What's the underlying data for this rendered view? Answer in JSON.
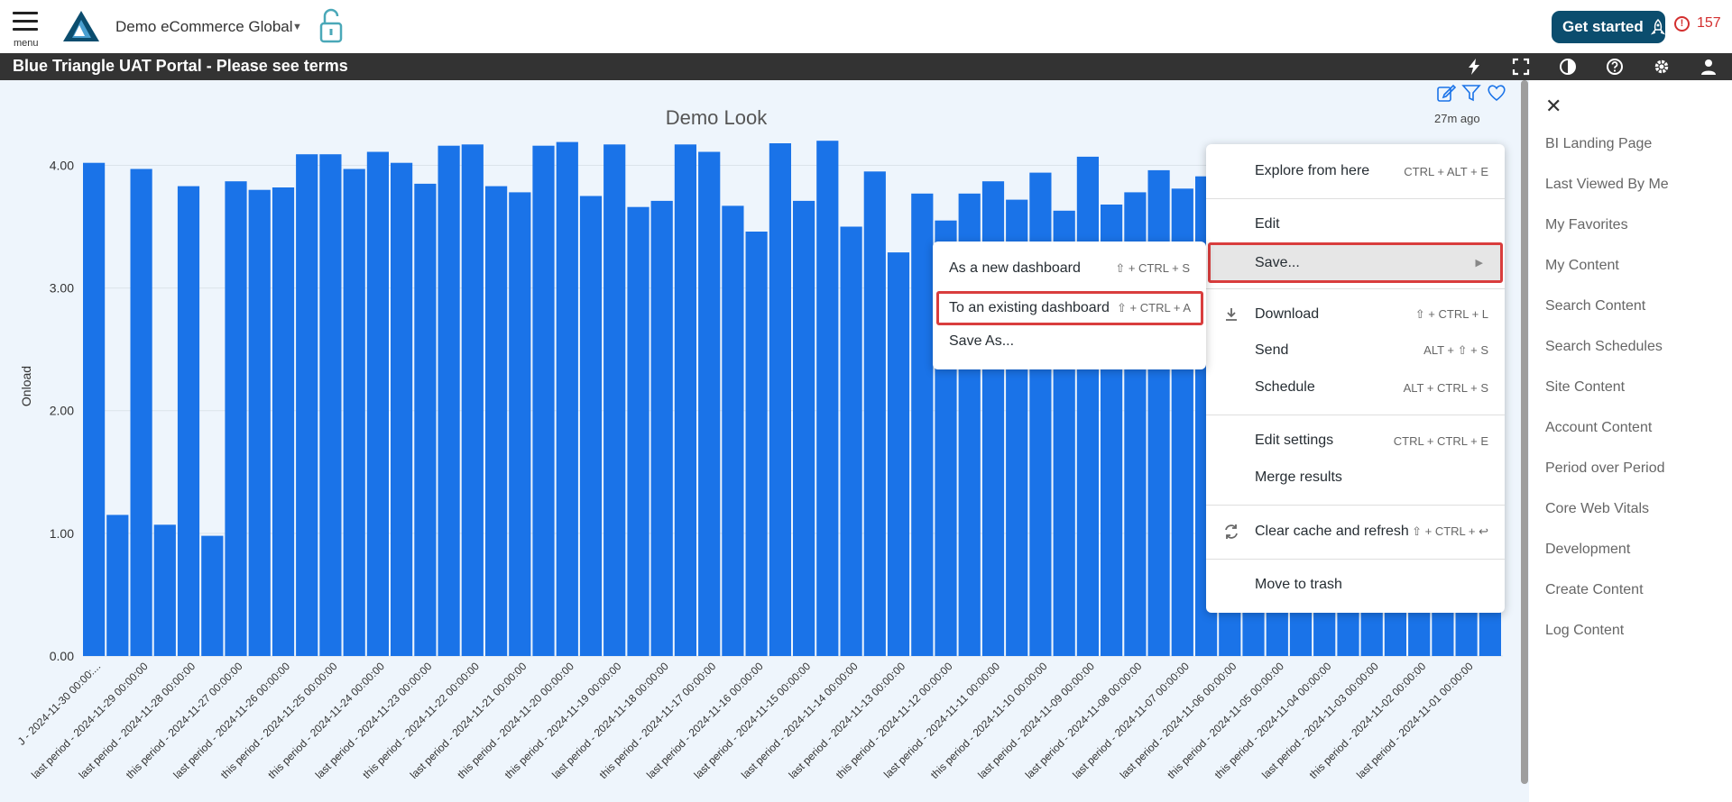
{
  "header": {
    "menu_label": "menu",
    "tenant": "Demo eCommerce Global",
    "get_started": "Get started",
    "alert_count": "157"
  },
  "band": {
    "title": "Blue Triangle UAT Portal - Please see terms",
    "icons": [
      "lightning-icon",
      "fullscreen-icon",
      "contrast-icon",
      "help-icon",
      "settings-icon",
      "user-icon"
    ]
  },
  "tile": {
    "updated": "27m ago"
  },
  "right_panel": {
    "items": [
      "BI Landing Page",
      "Last Viewed By Me",
      "My Favorites",
      "My Content",
      "Search Content",
      "Search Schedules",
      "Site Content",
      "Account Content",
      "Period over Period",
      "Core Web Vitals",
      "Development",
      "Create Content",
      "Log Content"
    ]
  },
  "context_menu": {
    "items": [
      {
        "label": "Explore from here",
        "shortcut": "CTRL + ALT + E"
      },
      {
        "label": "Edit",
        "shortcut": ""
      },
      {
        "label": "Save...",
        "shortcut": ""
      },
      {
        "label": "Download",
        "shortcut": "⇧ + CTRL + L"
      },
      {
        "label": "Send",
        "shortcut": "ALT + ⇧ + S"
      },
      {
        "label": "Schedule",
        "shortcut": "ALT + CTRL + S"
      },
      {
        "label": "Edit settings",
        "shortcut": "CTRL + CTRL + E"
      },
      {
        "label": "Merge results",
        "shortcut": ""
      },
      {
        "label": "Clear cache and refresh",
        "shortcut": "⇧ + CTRL + ↩"
      },
      {
        "label": "Move to trash",
        "shortcut": ""
      }
    ]
  },
  "save_submenu": {
    "items": [
      {
        "label": "As a new dashboard",
        "shortcut": "⇧ + CTRL + S"
      },
      {
        "label": "To an existing dashboard",
        "shortcut": "⇧ + CTRL + A"
      },
      {
        "label": "Save As...",
        "shortcut": ""
      }
    ]
  },
  "colors": {
    "bar": "#1a73e8",
    "highlight": "#d93d3d",
    "band": "#333333",
    "get_started_bg": "#0b4d6e"
  },
  "chart_data": {
    "type": "bar",
    "title": "Demo Look",
    "ylabel": "Onload",
    "xlabel": "",
    "ylim": [
      0,
      4.4
    ],
    "yticks": [
      "0.00",
      "1.00",
      "2.00",
      "3.00",
      "4.00"
    ],
    "grid": true,
    "categories": [
      "this period - 2024-11-30 00:00:...",
      "last period - 2024-11-30 00:00:00",
      "this period - 2024-11-29 00:00:00",
      "last period - 2024-11-29 00:00:00",
      "this period - 2024-11-28 00:00:00",
      "last period - 2024-11-28 00:00:00",
      "this period - 2024-11-27 00:00:00",
      "last period - 2024-11-27 00:00:00",
      "this period - 2024-11-26 00:00:00",
      "last period - 2024-11-26 00:00:00",
      "this period - 2024-11-25 00:00:00",
      "last period - 2024-11-25 00:00:00",
      "this period - 2024-11-24 00:00:00",
      "last period - 2024-11-24 00:00:00",
      "this period - 2024-11-23 00:00:00",
      "last period - 2024-11-23 00:00:00",
      "this period - 2024-11-22 00:00:00",
      "last period - 2024-11-22 00:00:00",
      "this period - 2024-11-21 00:00:00",
      "last period - 2024-11-21 00:00:00",
      "this period - 2024-11-20 00:00:00",
      "last period - 2024-11-20 00:00:00",
      "this period - 2024-11-19 00:00:00",
      "last period - 2024-11-19 00:00:00",
      "this period - 2024-11-18 00:00:00",
      "last period - 2024-11-18 00:00:00",
      "this period - 2024-11-17 00:00:00",
      "last period - 2024-11-17 00:00:00",
      "this period - 2024-11-16 00:00:00",
      "last period - 2024-11-16 00:00:00",
      "this period - 2024-11-15 00:00:00",
      "last period - 2024-11-15 00:00:00",
      "this period - 2024-11-14 00:00:00",
      "last period - 2024-11-14 00:00:00",
      "this period - 2024-11-13 00:00:00",
      "last period - 2024-11-13 00:00:00",
      "this period - 2024-11-12 00:00:00",
      "last period - 2024-11-12 00:00:00",
      "this period - 2024-11-11 00:00:00",
      "last period - 2024-11-11 00:00:00",
      "this period - 2024-11-10 00:00:00",
      "last period - 2024-11-10 00:00:00",
      "this period - 2024-11-09 00:00:00",
      "last period - 2024-11-09 00:00:00",
      "this period - 2024-11-08 00:00:00",
      "last period - 2024-11-08 00:00:00",
      "this period - 2024-11-07 00:00:00",
      "last period - 2024-11-07 00:00:00",
      "this period - 2024-11-06 00:00:00",
      "last period - 2024-11-06 00:00:00",
      "this period - 2024-11-05 00:00:00",
      "last period - 2024-11-05 00:00:00",
      "this period - 2024-11-04 00:00:00",
      "last period - 2024-11-04 00:00:00",
      "this period - 2024-11-03 00:00:00",
      "last period - 2024-11-03 00:00:00",
      "this period - 2024-11-02 00:00:00",
      "last period - 2024-11-02 00:00:00",
      "this period - 2024-11-01 00:00:00",
      "last period - 2024-11-01 00:00:00"
    ],
    "values": [
      4.02,
      1.15,
      3.97,
      1.07,
      3.83,
      0.98,
      3.87,
      3.8,
      3.82,
      4.09,
      4.09,
      3.97,
      4.11,
      4.02,
      3.85,
      4.16,
      4.17,
      3.83,
      3.78,
      4.16,
      4.19,
      3.75,
      4.17,
      3.66,
      3.71,
      4.17,
      4.11,
      3.67,
      3.46,
      4.18,
      3.71,
      4.2,
      3.5,
      3.95,
      3.29,
      3.77,
      3.55,
      3.77,
      3.87,
      3.72,
      3.94,
      3.63,
      4.07,
      3.68,
      3.78,
      3.96,
      3.81,
      3.91,
      3.75,
      3.85,
      3.7,
      3.9,
      3.8,
      3.65,
      3.88,
      3.72,
      3.83,
      3.6,
      3.79,
      3.74
    ],
    "labels_shown": [
      "J - 2024-11-30 00:00:...",
      "last period - 2024-11-29 00:00:00",
      "last period - 2024-11-28 00:00:00",
      "this period - 2024-11-27 00:00:00",
      "last period - 2024-11-26 00:00:00",
      "this period - 2024-11-25 00:00:00",
      "this period - 2024-11-24 00:00:00",
      "last period - 2024-11-23 00:00:00",
      "this period - 2024-11-22 00:00:00",
      "last period - 2024-11-21 00:00:00",
      "this period - 2024-11-20 00:00:00",
      "this period - 2024-11-19 00:00:00",
      "last period - 2024-11-18 00:00:00",
      "this period - 2024-11-17 00:00:00",
      "last period - 2024-11-16 00:00:00",
      "last period - 2024-11-15 00:00:00",
      "last period - 2024-11-14 00:00:00",
      "last period - 2024-11-13 00:00:00",
      "this period - 2024-11-12 00:00:00",
      "last period - 2024-11-11 00:00:00",
      "this period - 2024-11-10 00:00:00",
      "last period - 2024-11-09 00:00:00",
      "last period - 2024-11-08 00:00:00",
      "last period - 2024-11-07 00:00:00",
      "last period - 2024-11-06 00:00:00",
      "this period - 2024-11-05 00:00:00",
      "this period - 2024-11-04 00:00:00",
      "last period - 2024-11-03 00:00:00",
      "this period - 2024-11-02 00:00:00",
      "last period - 2024-11-01 00:00:00"
    ]
  }
}
